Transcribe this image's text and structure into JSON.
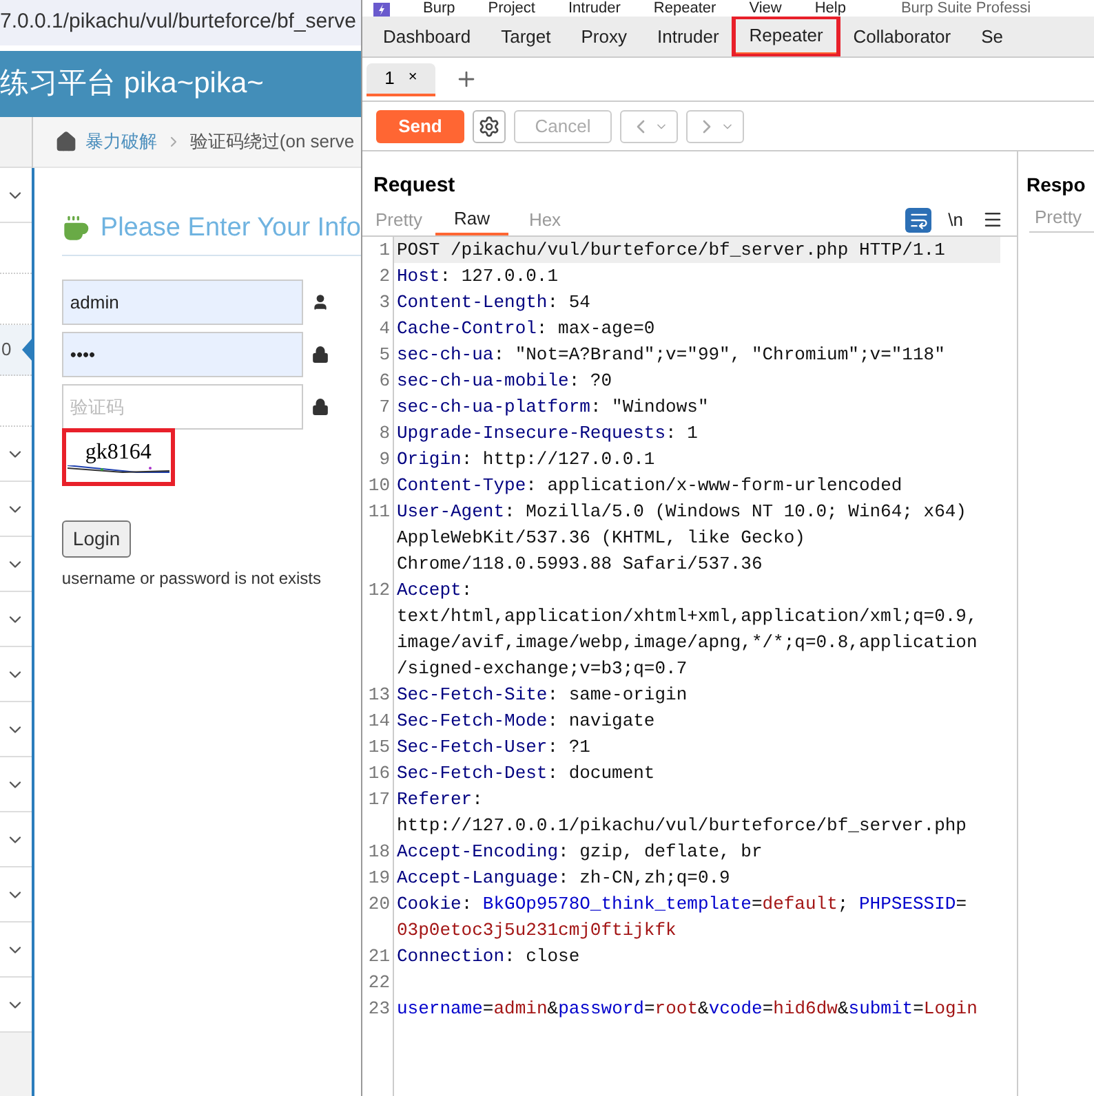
{
  "browser": {
    "address": "7.0.0.1/pikachu/vul/burteforce/bf_serve",
    "site_title": "练习平台 pika~pika~",
    "breadcrumb": [
      "暴力破解",
      "验证码绕过(on serve"
    ],
    "sidebar": [
      {
        "kind": "group"
      },
      {
        "kind": "item",
        "selected": false
      },
      {
        "kind": "item",
        "selected": false
      },
      {
        "kind": "item",
        "label": "0",
        "selected": true
      },
      {
        "kind": "item",
        "selected": false
      },
      {
        "kind": "group"
      },
      {
        "kind": "group"
      },
      {
        "kind": "group"
      },
      {
        "kind": "group"
      },
      {
        "kind": "group"
      },
      {
        "kind": "group"
      },
      {
        "kind": "group"
      },
      {
        "kind": "group"
      },
      {
        "kind": "group"
      },
      {
        "kind": "group"
      },
      {
        "kind": "group"
      }
    ],
    "form": {
      "title": "Please Enter Your Info",
      "username": "admin",
      "password": "••••",
      "vcode_placeholder": "验证码",
      "captcha": "gk8164",
      "captcha_highlighted": true,
      "button": "Login",
      "message": "username or password is not exists"
    }
  },
  "burp": {
    "menu": [
      "Burp",
      "Project",
      "Intruder",
      "Repeater",
      "View",
      "Help"
    ],
    "product": "Burp Suite Professi",
    "tabs": [
      {
        "label": "Dashboard",
        "selected": false,
        "highlighted": false
      },
      {
        "label": "Target",
        "selected": false,
        "highlighted": false
      },
      {
        "label": "Proxy",
        "selected": false,
        "highlighted": false
      },
      {
        "label": "Intruder",
        "selected": false,
        "highlighted": false
      },
      {
        "label": "Repeater",
        "selected": true,
        "highlighted": true
      },
      {
        "label": "Collaborator",
        "selected": false,
        "highlighted": false
      },
      {
        "label": "Se",
        "selected": false,
        "highlighted": false
      }
    ],
    "repeater_tabs": [
      {
        "label": "1",
        "close": "×",
        "selected": true
      }
    ],
    "toolbar": {
      "send": "Send",
      "cancel": "Cancel",
      "cancel_disabled": true
    },
    "request": {
      "title": "Request",
      "view_tabs": [
        {
          "label": "Pretty",
          "selected": false
        },
        {
          "label": "Raw",
          "selected": true
        },
        {
          "label": "Hex",
          "selected": false
        }
      ],
      "wrap_on": true,
      "newline_toggle": "\\n",
      "lines": [
        {
          "number": "1",
          "highlighted": true,
          "rows": [
            [
              {
                "kind": "text",
                "text": "POST /pikachu/vul/burteforce/bf_server.php HTTP/1.1"
              }
            ]
          ]
        },
        {
          "number": "2",
          "highlighted": false,
          "rows": [
            [
              {
                "kind": "name",
                "text": "Host"
              },
              {
                "kind": "text",
                "text": ": 127.0.0.1"
              }
            ]
          ]
        },
        {
          "number": "3",
          "highlighted": false,
          "rows": [
            [
              {
                "kind": "name",
                "text": "Content-Length"
              },
              {
                "kind": "text",
                "text": ": 54"
              }
            ]
          ]
        },
        {
          "number": "4",
          "highlighted": false,
          "rows": [
            [
              {
                "kind": "name",
                "text": "Cache-Control"
              },
              {
                "kind": "text",
                "text": ": max-age=0"
              }
            ]
          ]
        },
        {
          "number": "5",
          "highlighted": false,
          "rows": [
            [
              {
                "kind": "name",
                "text": "sec-ch-ua"
              },
              {
                "kind": "text",
                "text": ": \"Not=A?Brand\";v=\"99\", \"Chromium\";v=\"118\""
              }
            ]
          ]
        },
        {
          "number": "6",
          "highlighted": false,
          "rows": [
            [
              {
                "kind": "name",
                "text": "sec-ch-ua-mobile"
              },
              {
                "kind": "text",
                "text": ": ?0"
              }
            ]
          ]
        },
        {
          "number": "7",
          "highlighted": false,
          "rows": [
            [
              {
                "kind": "name",
                "text": "sec-ch-ua-platform"
              },
              {
                "kind": "text",
                "text": ": \"Windows\""
              }
            ]
          ]
        },
        {
          "number": "8",
          "highlighted": false,
          "rows": [
            [
              {
                "kind": "name",
                "text": "Upgrade-Insecure-Requests"
              },
              {
                "kind": "text",
                "text": ": 1"
              }
            ]
          ]
        },
        {
          "number": "9",
          "highlighted": false,
          "rows": [
            [
              {
                "kind": "name",
                "text": "Origin"
              },
              {
                "kind": "text",
                "text": ": http://127.0.0.1"
              }
            ]
          ]
        },
        {
          "number": "10",
          "highlighted": false,
          "rows": [
            [
              {
                "kind": "name",
                "text": "Content-Type"
              },
              {
                "kind": "text",
                "text": ": application/x-www-form-urlencoded"
              }
            ]
          ]
        },
        {
          "number": "11",
          "highlighted": false,
          "rows": [
            [
              {
                "kind": "name",
                "text": "User-Agent"
              },
              {
                "kind": "text",
                "text": ": Mozilla/5.0 (Windows NT 10.0; Win64; x64)"
              }
            ],
            [
              {
                "kind": "text",
                "text": "AppleWebKit/537.36 (KHTML, like Gecko)"
              }
            ],
            [
              {
                "kind": "text",
                "text": "Chrome/118.0.5993.88 Safari/537.36"
              }
            ]
          ]
        },
        {
          "number": "12",
          "highlighted": false,
          "rows": [
            [
              {
                "kind": "name",
                "text": "Accept"
              },
              {
                "kind": "text",
                "text": ":"
              }
            ],
            [
              {
                "kind": "text",
                "text": "text/html,application/xhtml+xml,application/xml;q=0.9,"
              }
            ],
            [
              {
                "kind": "text",
                "text": "image/avif,image/webp,image/apng,*/*;q=0.8,application"
              }
            ],
            [
              {
                "kind": "text",
                "text": "/signed-exchange;v=b3;q=0.7"
              }
            ]
          ]
        },
        {
          "number": "13",
          "highlighted": false,
          "rows": [
            [
              {
                "kind": "name",
                "text": "Sec-Fetch-Site"
              },
              {
                "kind": "text",
                "text": ": same-origin"
              }
            ]
          ]
        },
        {
          "number": "14",
          "highlighted": false,
          "rows": [
            [
              {
                "kind": "name",
                "text": "Sec-Fetch-Mode"
              },
              {
                "kind": "text",
                "text": ": navigate"
              }
            ]
          ]
        },
        {
          "number": "15",
          "highlighted": false,
          "rows": [
            [
              {
                "kind": "name",
                "text": "Sec-Fetch-User"
              },
              {
                "kind": "text",
                "text": ": ?1"
              }
            ]
          ]
        },
        {
          "number": "16",
          "highlighted": false,
          "rows": [
            [
              {
                "kind": "name",
                "text": "Sec-Fetch-Dest"
              },
              {
                "kind": "text",
                "text": ": document"
              }
            ]
          ]
        },
        {
          "number": "17",
          "highlighted": false,
          "rows": [
            [
              {
                "kind": "name",
                "text": "Referer"
              },
              {
                "kind": "text",
                "text": ":"
              }
            ],
            [
              {
                "kind": "text",
                "text": "http://127.0.0.1/pikachu/vul/burteforce/bf_server.php"
              }
            ]
          ]
        },
        {
          "number": "18",
          "highlighted": false,
          "rows": [
            [
              {
                "kind": "name",
                "text": "Accept-Encoding"
              },
              {
                "kind": "text",
                "text": ": gzip, deflate, br"
              }
            ]
          ]
        },
        {
          "number": "19",
          "highlighted": false,
          "rows": [
            [
              {
                "kind": "name",
                "text": "Accept-Language"
              },
              {
                "kind": "text",
                "text": ": zh-CN,zh;q=0.9"
              }
            ]
          ]
        },
        {
          "number": "20",
          "highlighted": false,
          "rows": [
            [
              {
                "kind": "name",
                "text": "Cookie"
              },
              {
                "kind": "text",
                "text": ": "
              },
              {
                "kind": "param",
                "text": "BkGOp9578O_think_template"
              },
              {
                "kind": "text",
                "text": "="
              },
              {
                "kind": "value",
                "text": "default"
              },
              {
                "kind": "text",
                "text": "; "
              },
              {
                "kind": "param",
                "text": "PHPSESSID"
              },
              {
                "kind": "text",
                "text": "="
              }
            ],
            [
              {
                "kind": "value",
                "text": "03p0etoc3j5u231cmj0ftijkfk"
              }
            ]
          ]
        },
        {
          "number": "21",
          "highlighted": false,
          "rows": [
            [
              {
                "kind": "name",
                "text": "Connection"
              },
              {
                "kind": "text",
                "text": ": close"
              }
            ]
          ]
        },
        {
          "number": "22",
          "highlighted": false,
          "rows": [
            []
          ]
        },
        {
          "number": "23",
          "highlighted": false,
          "rows": [
            [
              {
                "kind": "param",
                "text": "username"
              },
              {
                "kind": "text",
                "text": "="
              },
              {
                "kind": "value",
                "text": "admin"
              },
              {
                "kind": "text",
                "text": "&"
              },
              {
                "kind": "param",
                "text": "password"
              },
              {
                "kind": "text",
                "text": "="
              },
              {
                "kind": "value",
                "text": "root"
              },
              {
                "kind": "text",
                "text": "&"
              },
              {
                "kind": "param",
                "text": "vcode"
              },
              {
                "kind": "text",
                "text": "="
              },
              {
                "kind": "value",
                "text": "hid6dw"
              },
              {
                "kind": "text",
                "text": "&"
              },
              {
                "kind": "param",
                "text": "submit"
              },
              {
                "kind": "text",
                "text": "="
              },
              {
                "kind": "value",
                "text": "Login"
              }
            ]
          ]
        }
      ]
    },
    "response": {
      "title": "Respo",
      "view_tab": "Pretty"
    }
  }
}
